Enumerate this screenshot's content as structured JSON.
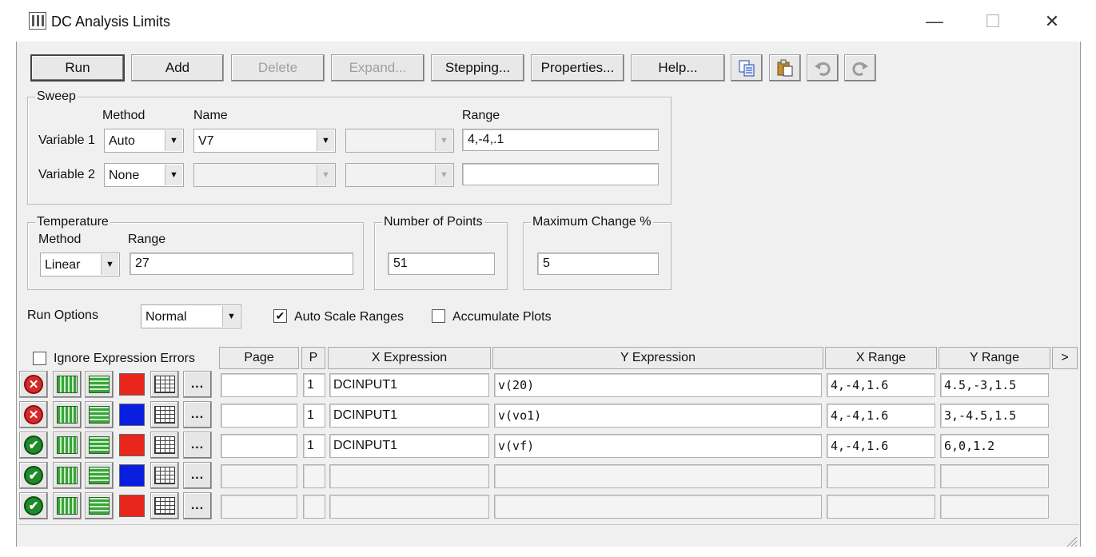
{
  "window": {
    "title": "DC Analysis Limits",
    "controls": {
      "minimize": "—",
      "maximize": "☐",
      "close": "✕"
    }
  },
  "toolbar": {
    "buttons": [
      {
        "label": "Run",
        "enabled": true
      },
      {
        "label": "Add",
        "enabled": true
      },
      {
        "label": "Delete",
        "enabled": false
      },
      {
        "label": "Expand...",
        "enabled": false
      },
      {
        "label": "Stepping...",
        "enabled": true
      },
      {
        "label": "Properties...",
        "enabled": true
      },
      {
        "label": "Help...",
        "enabled": true
      }
    ],
    "icons": [
      "copy-icon",
      "paste-icon",
      "undo-icon",
      "redo-icon"
    ]
  },
  "sweep": {
    "group_label": "Sweep",
    "headers": {
      "method": "Method",
      "name": "Name",
      "range": "Range"
    },
    "variable1": {
      "label": "Variable 1",
      "method": "Auto",
      "name": "V7",
      "range": "4,-4,.1"
    },
    "variable2": {
      "label": "Variable 2",
      "method": "None",
      "name": "",
      "range": ""
    }
  },
  "temperature": {
    "group_label": "Temperature",
    "method_label": "Method",
    "range_label": "Range",
    "method": "Linear",
    "range": "27"
  },
  "number_of_points": {
    "label": "Number of Points",
    "value": "51"
  },
  "maximum_change": {
    "label": "Maximum Change %",
    "value": "5"
  },
  "run_options": {
    "label": "Run Options",
    "value": "Normal",
    "auto_scale_ranges": {
      "label": "Auto Scale Ranges",
      "checked": true
    },
    "accumulate_plots": {
      "label": "Accumulate Plots",
      "checked": false
    }
  },
  "plots": {
    "ignore_errors": {
      "label": "Ignore Expression Errors",
      "checked": false
    },
    "columns": [
      "Page",
      "P",
      "X Expression",
      "Y Expression",
      "X Range",
      "Y Range",
      ">"
    ],
    "rows": [
      {
        "status": "error",
        "color": "#e8261c",
        "page": "",
        "p": "1",
        "x_expr": "DCINPUT1",
        "y_expr": "v(20)",
        "x_range": "4,-4,1.6",
        "y_range": "4.5,-3,1.5"
      },
      {
        "status": "error",
        "color": "#0a1ee0",
        "page": "",
        "p": "1",
        "x_expr": "DCINPUT1",
        "y_expr": "v(vo1)",
        "x_range": "4,-4,1.6",
        "y_range": "3,-4.5,1.5"
      },
      {
        "status": "ok",
        "color": "#e8261c",
        "page": "",
        "p": "1",
        "x_expr": "DCINPUT1",
        "y_expr": "v(vf)",
        "x_range": "4,-4,1.6",
        "y_range": "6,0,1.2"
      },
      {
        "status": "ok",
        "color": "#0a1ee0",
        "page": "",
        "p": "",
        "x_expr": "",
        "y_expr": "",
        "x_range": "",
        "y_range": ""
      },
      {
        "status": "ok",
        "color": "#e8261c",
        "page": "",
        "p": "",
        "x_expr": "",
        "y_expr": "",
        "x_range": "",
        "y_range": ""
      }
    ],
    "more_button": "..."
  }
}
